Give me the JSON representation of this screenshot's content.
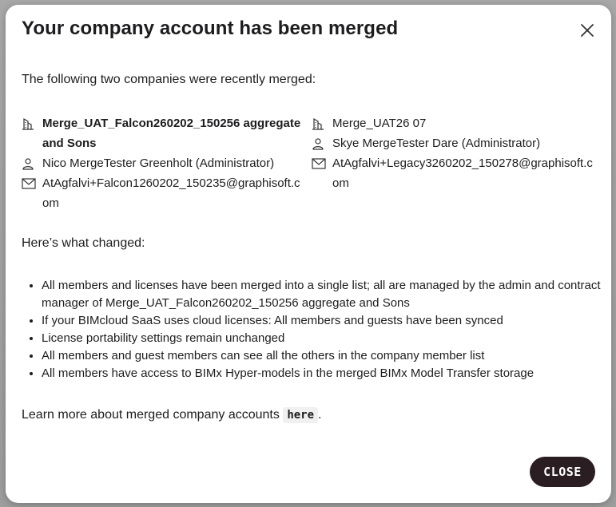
{
  "dialog": {
    "title": "Your company account has been merged",
    "intro": "The following two companies were recently merged:",
    "companies": [
      {
        "name": "Merge_UAT_Falcon260202_150256 aggregate and Sons",
        "admin": "Nico MergeTester Greenholt (Administrator)",
        "email": "AtAgfalvi+Falcon1260202_150235@graphisoft.com"
      },
      {
        "name": "Merge_UAT26 07",
        "admin": "Skye MergeTester Dare (Administrator)",
        "email": "AtAgfalvi+Legacy3260202_150278@graphisoft.com"
      }
    ],
    "changes_heading": "Here’s what changed:",
    "changes": [
      "All members and licenses have been merged into a single list; all are managed by the admin and contract manager of Merge_UAT_Falcon260202_150256 aggregate and Sons",
      "If your BIMcloud SaaS uses cloud licenses: All members and guests have been synced",
      "License portability settings remain unchanged",
      "All members and guest members can see all the others in the company member list",
      "All members have access to BIMx Hyper-models in the merged BIMx Model Transfer storage"
    ],
    "learn_more": "Learn more about merged company accounts",
    "learn_more_link": "here",
    "learn_more_end": ".",
    "close_button": "CLOSE"
  },
  "icons": {
    "close": "close-icon",
    "company": "building-icon",
    "admin": "user-icon",
    "email": "mail-icon"
  },
  "colors": {
    "text": "#1d1d1f",
    "button_bg": "#2a1e22",
    "button_text": "#ffffff"
  }
}
